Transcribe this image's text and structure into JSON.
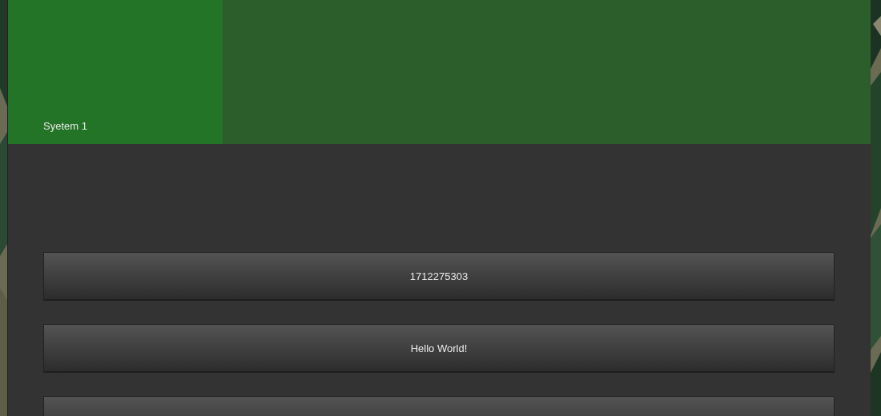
{
  "tabs": [
    {
      "label": "Syetem 1",
      "selected": true
    }
  ],
  "buttons": [
    {
      "kind": "labeled",
      "label": "1712275303"
    },
    {
      "kind": "labeled",
      "label": "Hello World!"
    },
    {
      "kind": "blank"
    }
  ]
}
